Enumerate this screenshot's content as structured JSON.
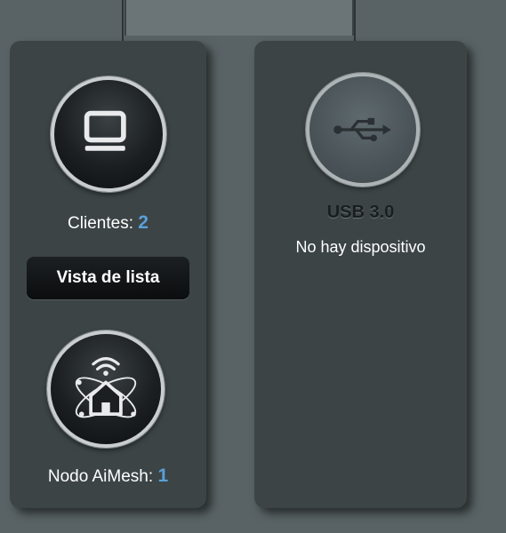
{
  "clients": {
    "label": "Clientes:",
    "count": "2",
    "icon": "monitor-icon"
  },
  "list_view_button": "Vista de lista",
  "aimesh": {
    "label": "Nodo AiMesh:",
    "count": "1",
    "icon": "aimesh-home-icon"
  },
  "usb": {
    "title": "USB 3.0",
    "status": "No hay dispositivo",
    "icon": "usb-icon"
  },
  "colors": {
    "background": "#596365",
    "panel": "#3c4446",
    "count_accent": "#5aa0d8"
  }
}
